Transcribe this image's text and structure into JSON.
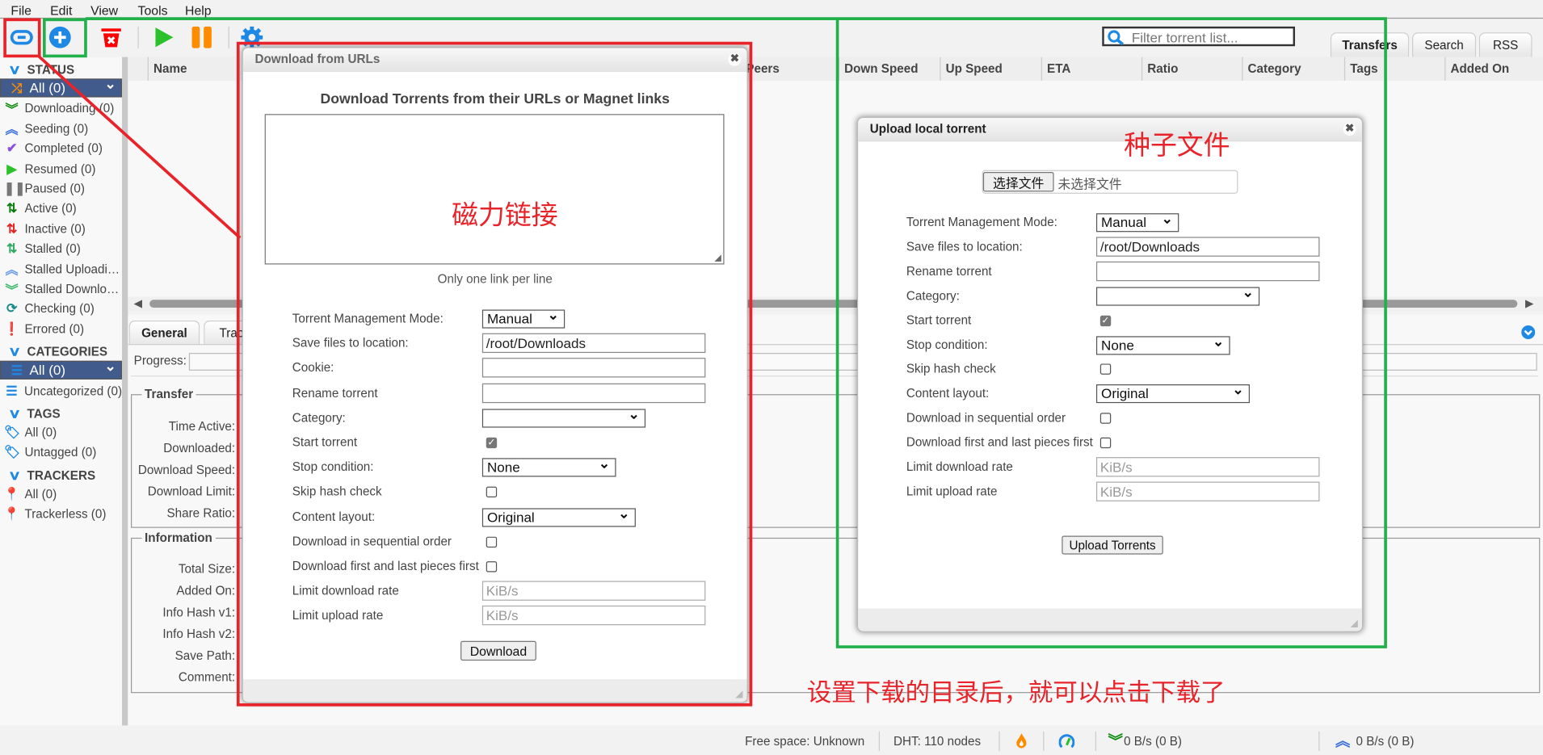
{
  "menu": [
    "File",
    "Edit",
    "View",
    "Tools",
    "Help"
  ],
  "toolbar": {
    "buttons": [
      "add-torrent-link",
      "add-torrent-file",
      "delete",
      "resume",
      "pause",
      "options"
    ]
  },
  "search": {
    "placeholder": "Filter torrent list..."
  },
  "tabs": [
    "Transfers",
    "Search",
    "RSS"
  ],
  "sidebar": {
    "status_header": "STATUS",
    "status": [
      {
        "label": "All (0)",
        "icon": "shuffle-icon",
        "color": "#ff8c00",
        "selected": true
      },
      {
        "label": "Downloading (0)",
        "icon": "double-chevron-down-icon",
        "color": "#0a8a0a"
      },
      {
        "label": "Seeding (0)",
        "icon": "double-chevron-up-icon",
        "color": "#3b6fe0"
      },
      {
        "label": "Completed (0)",
        "icon": "check-icon",
        "color": "#8a4fe0"
      },
      {
        "label": "Resumed (0)",
        "icon": "play-icon",
        "color": "#2ac12a"
      },
      {
        "label": "Paused (0)",
        "icon": "pause-icon",
        "color": "#777777"
      },
      {
        "label": "Active (0)",
        "icon": "up-down-arrows-icon",
        "color": "#0a7a0a"
      },
      {
        "label": "Inactive (0)",
        "icon": "up-down-arrows-icon",
        "color": "#e82020"
      },
      {
        "label": "Stalled (0)",
        "icon": "up-down-arrows-icon",
        "color": "#30a860"
      },
      {
        "label": "Stalled Uploadi…",
        "icon": "double-chevron-up-icon",
        "color": "#6a9ae8"
      },
      {
        "label": "Stalled Downlo…",
        "icon": "double-chevron-down-icon",
        "color": "#3cb86a"
      },
      {
        "label": "Checking (0)",
        "icon": "refresh-icon",
        "color": "#1a8a8a"
      },
      {
        "label": "Errored (0)",
        "icon": "error-icon",
        "color": "#e81010"
      }
    ],
    "categories_header": "CATEGORIES",
    "categories": [
      {
        "label": "All (0)",
        "icon": "list-icon",
        "color": "#1e88e5",
        "selected": true
      },
      {
        "label": "Uncategorized (0)",
        "icon": "list-icon",
        "color": "#1e88e5"
      }
    ],
    "tags_header": "TAGS",
    "tags": [
      {
        "label": "All (0)",
        "icon": "tag-icon",
        "color": "#1e88e5"
      },
      {
        "label": "Untagged (0)",
        "icon": "tag-icon",
        "color": "#1e88e5"
      }
    ],
    "trackers_header": "TRACKERS",
    "trackers": [
      {
        "label": "All (0)",
        "icon": "pin-icon",
        "color": "#1e88e5"
      },
      {
        "label": "Trackerless (0)",
        "icon": "pin-icon",
        "color": "#1e88e5"
      }
    ]
  },
  "table": {
    "columns": [
      "Name",
      "Peers",
      "Down Speed",
      "Up Speed",
      "ETA",
      "Ratio",
      "Category",
      "Tags",
      "Added On"
    ]
  },
  "details": {
    "tabs": [
      "General",
      "Trackers"
    ],
    "progress_label": "Progress:",
    "transfer_legend": "Transfer",
    "transfer_fields": [
      "Time Active:",
      "Downloaded:",
      "Download Speed:",
      "Download Limit:",
      "Share Ratio:"
    ],
    "information_legend": "Information",
    "information_fields": [
      "Total Size:",
      "Added On:",
      "Info Hash v1:",
      "Info Hash v2:",
      "Save Path:",
      "Comment:"
    ]
  },
  "statusbar": {
    "free_space": "Free space: Unknown",
    "dht": "DHT: 110 nodes",
    "download": "0 B/s (0 B)",
    "upload": "0 B/s (0 B)"
  },
  "url_dialog": {
    "title": "Download from URLs",
    "heading": "Download Torrents from their URLs or Magnet links",
    "textarea_value": "",
    "hint": "Only one link per line",
    "fields": [
      {
        "label": "Torrent Management Mode:",
        "type": "select",
        "value": "Manual"
      },
      {
        "label": "Save files to location:",
        "type": "text",
        "value": "/root/Downloads"
      },
      {
        "label": "Cookie:",
        "type": "text",
        "value": ""
      },
      {
        "label": "Rename torrent",
        "type": "text",
        "value": ""
      },
      {
        "label": "Category:",
        "type": "select",
        "value": ""
      },
      {
        "label": "Start torrent",
        "type": "checkbox",
        "checked": true
      },
      {
        "label": "Stop condition:",
        "type": "select",
        "value": "None"
      },
      {
        "label": "Skip hash check",
        "type": "checkbox",
        "checked": false
      },
      {
        "label": "Content layout:",
        "type": "select",
        "value": "Original"
      },
      {
        "label": "Download in sequential order",
        "type": "checkbox",
        "checked": false
      },
      {
        "label": "Download first and last pieces first",
        "type": "checkbox",
        "checked": false
      },
      {
        "label": "Limit download rate",
        "type": "text",
        "value": "",
        "placeholder": "KiB/s"
      },
      {
        "label": "Limit upload rate",
        "type": "text",
        "value": "",
        "placeholder": "KiB/s"
      }
    ],
    "submit": "Download"
  },
  "file_dialog": {
    "title": "Upload local torrent",
    "choose_button": "选择文件",
    "no_file": "未选择文件",
    "fields": [
      {
        "label": "Torrent Management Mode:",
        "type": "select",
        "value": "Manual"
      },
      {
        "label": "Save files to location:",
        "type": "text",
        "value": "/root/Downloads"
      },
      {
        "label": "Rename torrent",
        "type": "text",
        "value": ""
      },
      {
        "label": "Category:",
        "type": "select",
        "value": ""
      },
      {
        "label": "Start torrent",
        "type": "checkbox",
        "checked": true
      },
      {
        "label": "Stop condition:",
        "type": "select",
        "value": "None"
      },
      {
        "label": "Skip hash check",
        "type": "checkbox",
        "checked": false
      },
      {
        "label": "Content layout:",
        "type": "select",
        "value": "Original"
      },
      {
        "label": "Download in sequential order",
        "type": "checkbox",
        "checked": false
      },
      {
        "label": "Download first and last pieces first",
        "type": "checkbox",
        "checked": false
      },
      {
        "label": "Limit download rate",
        "type": "text",
        "value": "",
        "placeholder": "KiB/s"
      },
      {
        "label": "Limit upload rate",
        "type": "text",
        "value": "",
        "placeholder": "KiB/s"
      }
    ],
    "submit": "Upload Torrents"
  },
  "annotations": {
    "magnet": "磁力链接",
    "torrent_file": "种子文件",
    "instruction": "设置下载的目录后，就可以点击下载了",
    "red": "#e8232a",
    "green": "#22b04b"
  }
}
